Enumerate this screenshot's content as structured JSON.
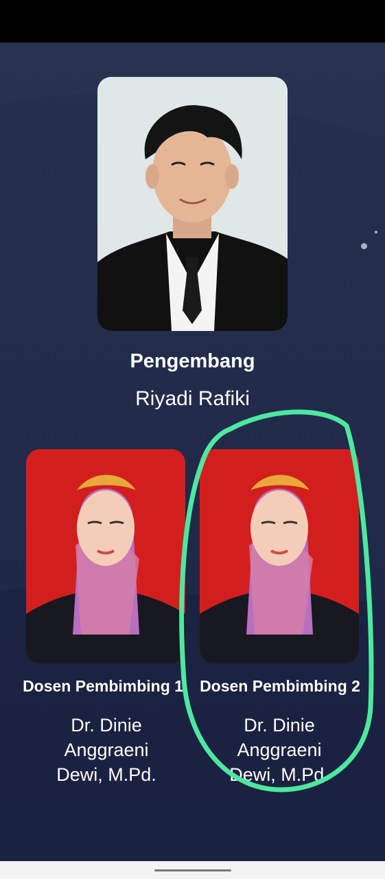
{
  "developer": {
    "role": "Pengembang",
    "name": "Riyadi Rafiki"
  },
  "advisors": [
    {
      "role": "Dosen Pembimbing 1",
      "name": "Dr. Dinie Anggraeni Dewi, M.Pd."
    },
    {
      "role": "Dosen Pembimbing 2",
      "name": "Dr. Dinie Anggraeni Dewi, M.Pd."
    }
  ],
  "colors": {
    "background": "#1f2844",
    "photo_bg_developer": "#dfe7e7",
    "photo_bg_advisor": "#d21f1e",
    "annotation": "#4de8a0"
  }
}
